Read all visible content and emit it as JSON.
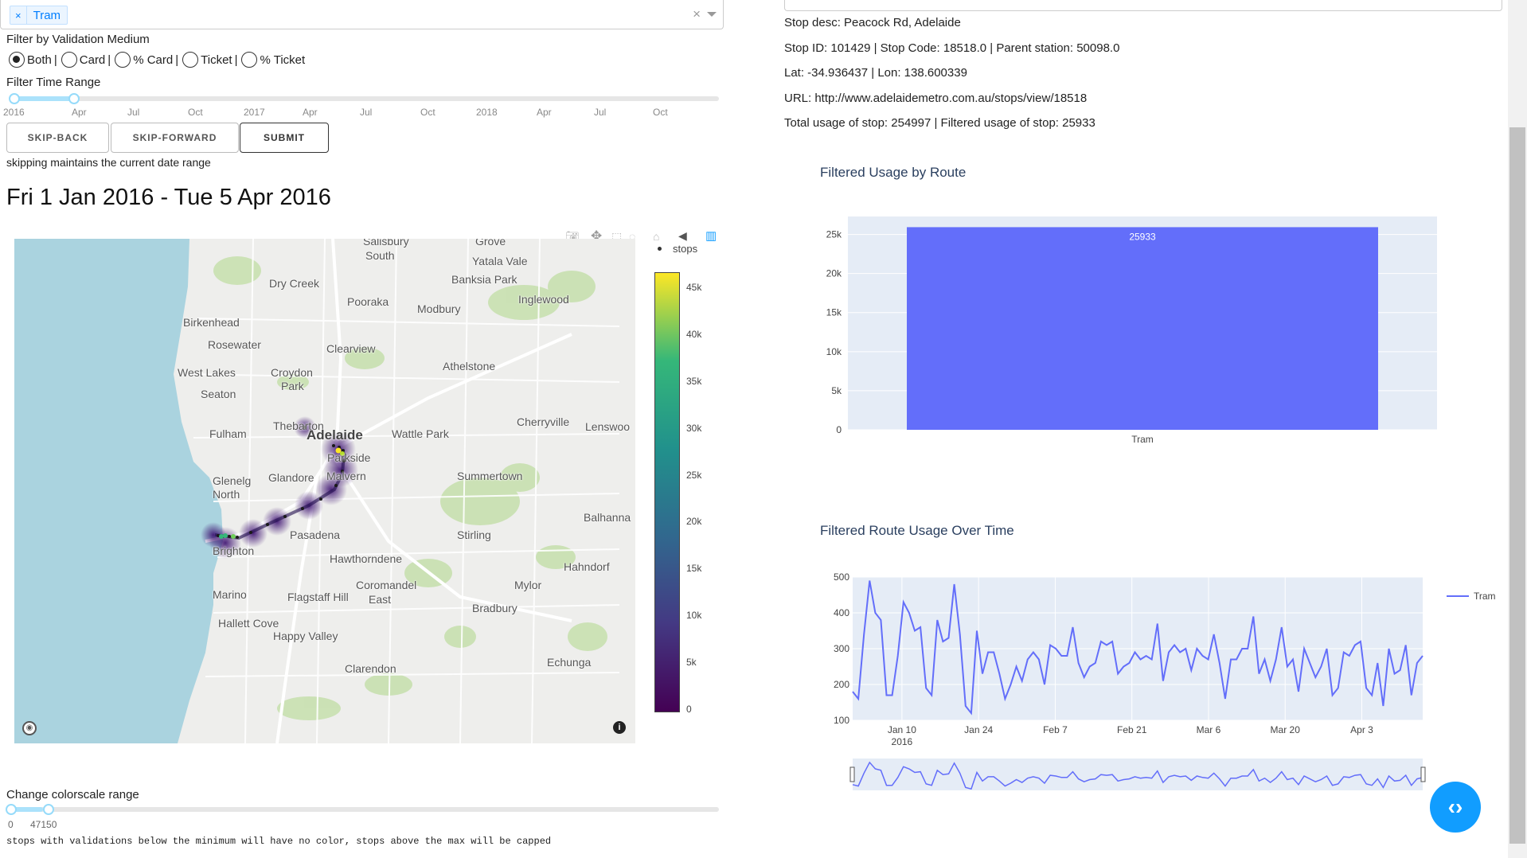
{
  "route_filter": {
    "selected_chip": "Tram",
    "clear_symbol": "×"
  },
  "validation": {
    "title": "Filter by Validation Medium",
    "options": [
      {
        "label": "Both",
        "selected": true
      },
      {
        "label": "Card",
        "selected": false
      },
      {
        "label": "% Card",
        "selected": false
      },
      {
        "label": "Ticket",
        "selected": false
      },
      {
        "label": "% Ticket",
        "selected": false
      }
    ],
    "separator": "|"
  },
  "time_range": {
    "title": "Filter Time Range",
    "ticks": [
      "2016",
      "Apr",
      "Jul",
      "Oct",
      "2017",
      "Apr",
      "Jul",
      "Oct",
      "2018",
      "Apr",
      "Jul",
      "Oct"
    ],
    "selected_fraction": [
      0.0,
      0.09
    ]
  },
  "buttons": {
    "skip_back": "SKIP-BACK",
    "skip_forward": "SKIP-FORWARD",
    "submit": "SUBMIT"
  },
  "skip_note": "skipping maintains the current date range",
  "date_heading": "Fri 1 Jan 2016 - Tue 5 Apr 2016",
  "map": {
    "legend_label": "stops",
    "colorscale_ticks": [
      "45k",
      "40k",
      "35k",
      "30k",
      "25k",
      "20k",
      "15k",
      "10k",
      "5k",
      "0"
    ],
    "colorscale_colors": [
      "#fde725",
      "#35b779",
      "#21918c",
      "#31688e",
      "#443983",
      "#440154"
    ],
    "places": [
      {
        "name": "Salisbury",
        "small": true
      },
      {
        "name": "South"
      },
      {
        "name": "Grove"
      },
      {
        "name": "Yatala Vale"
      },
      {
        "name": "Banksia Park"
      },
      {
        "name": "Dry Creek"
      },
      {
        "name": "Inglewood"
      },
      {
        "name": "Pooraka"
      },
      {
        "name": "Modbury"
      },
      {
        "name": "Birkenhead"
      },
      {
        "name": "Rosewater"
      },
      {
        "name": "Clearview"
      },
      {
        "name": "Athelstone"
      },
      {
        "name": "West Lakes"
      },
      {
        "name": "Croydon"
      },
      {
        "name": "Park"
      },
      {
        "name": "Seaton"
      },
      {
        "name": "Cherryville"
      },
      {
        "name": "Thebarton"
      },
      {
        "name": "Adelaide",
        "big": true
      },
      {
        "name": "Lenswoo"
      },
      {
        "name": "Fulham"
      },
      {
        "name": "Wattle Park"
      },
      {
        "name": "Parkside"
      },
      {
        "name": "Glenelg"
      },
      {
        "name": "North"
      },
      {
        "name": "Glandore"
      },
      {
        "name": "Malvern"
      },
      {
        "name": "Summertown"
      },
      {
        "name": "Balhanna"
      },
      {
        "name": "Pasadena"
      },
      {
        "name": "Stirling"
      },
      {
        "name": "Brighton"
      },
      {
        "name": "Hawthorndene"
      },
      {
        "name": "Hahndorf"
      },
      {
        "name": "Coromandel"
      },
      {
        "name": "East"
      },
      {
        "name": "Mylor"
      },
      {
        "name": "Marino"
      },
      {
        "name": "Flagstaff Hill"
      },
      {
        "name": "Bradbury"
      },
      {
        "name": "Hallett Cove"
      },
      {
        "name": "Happy Valley"
      },
      {
        "name": "Clarendon"
      },
      {
        "name": "Echunga"
      }
    ],
    "info_icon": "i",
    "logo_icon": "mapbox-logo"
  },
  "colorscale_range": {
    "title": "Change colorscale range",
    "min_label": "0",
    "max_label": "47150",
    "note": "stops with validations below the minimum will have no color, stops above the max will be capped"
  },
  "stop_info": {
    "desc": "Stop desc: Peacock Rd, Adelaide",
    "ids": "Stop ID: 101429 | Stop Code: 18518.0 | Parent station: 50098.0",
    "latlon": "Lat: -34.936437 | Lon: 138.600339",
    "url": "URL: http://www.adelaidemetro.com.au/stops/view/18518",
    "usage": "Total usage of stop: 254997 | Filtered usage of stop: 25933"
  },
  "colors": {
    "bar": "#636efa",
    "plot_bg": "#e5ecf6",
    "title": "#2a3f5f",
    "accent": "#119dff"
  },
  "chart_data": [
    {
      "type": "bar",
      "title": "Filtered Usage by Route",
      "categories": [
        "Tram"
      ],
      "values": [
        25933
      ],
      "data_labels": [
        "25933"
      ],
      "ylim": [
        0,
        27300
      ],
      "yticks": [
        "0",
        "5k",
        "10k",
        "15k",
        "20k",
        "25k"
      ],
      "ytick_values": [
        0,
        5000,
        10000,
        15000,
        20000,
        25000
      ],
      "grid": true
    },
    {
      "type": "line",
      "title": "Filtered Route Usage Over Time",
      "series": [
        {
          "name": "Tram",
          "values": [
            180,
            160,
            340,
            490,
            400,
            380,
            170,
            170,
            280,
            430,
            400,
            350,
            360,
            190,
            170,
            380,
            320,
            330,
            480,
            340,
            140,
            120,
            350,
            230,
            290,
            290,
            230,
            160,
            200,
            250,
            210,
            270,
            290,
            270,
            200,
            310,
            300,
            280,
            280,
            360,
            260,
            220,
            250,
            260,
            320,
            310,
            320,
            230,
            250,
            260,
            290,
            270,
            280,
            270,
            370,
            210,
            290,
            310,
            290,
            300,
            240,
            300,
            280,
            270,
            340,
            260,
            160,
            270,
            270,
            300,
            300,
            390,
            230,
            270,
            210,
            270,
            360,
            250,
            270,
            180,
            300,
            260,
            220,
            250,
            300,
            170,
            190,
            290,
            280,
            310,
            320,
            190,
            170,
            260,
            140,
            300,
            230,
            240,
            310,
            170,
            260,
            280
          ]
        }
      ],
      "ylim": [
        100,
        500
      ],
      "yticks": [
        "100",
        "200",
        "300",
        "400",
        "500"
      ],
      "xticks": [
        "Jan 10",
        "Jan 24",
        "Feb 7",
        "Feb 21",
        "Mar 6",
        "Mar 20",
        "Apr 3"
      ],
      "xtick_sublabel": "2016",
      "legend": "top-right",
      "grid": true,
      "range_slider": true
    }
  ]
}
